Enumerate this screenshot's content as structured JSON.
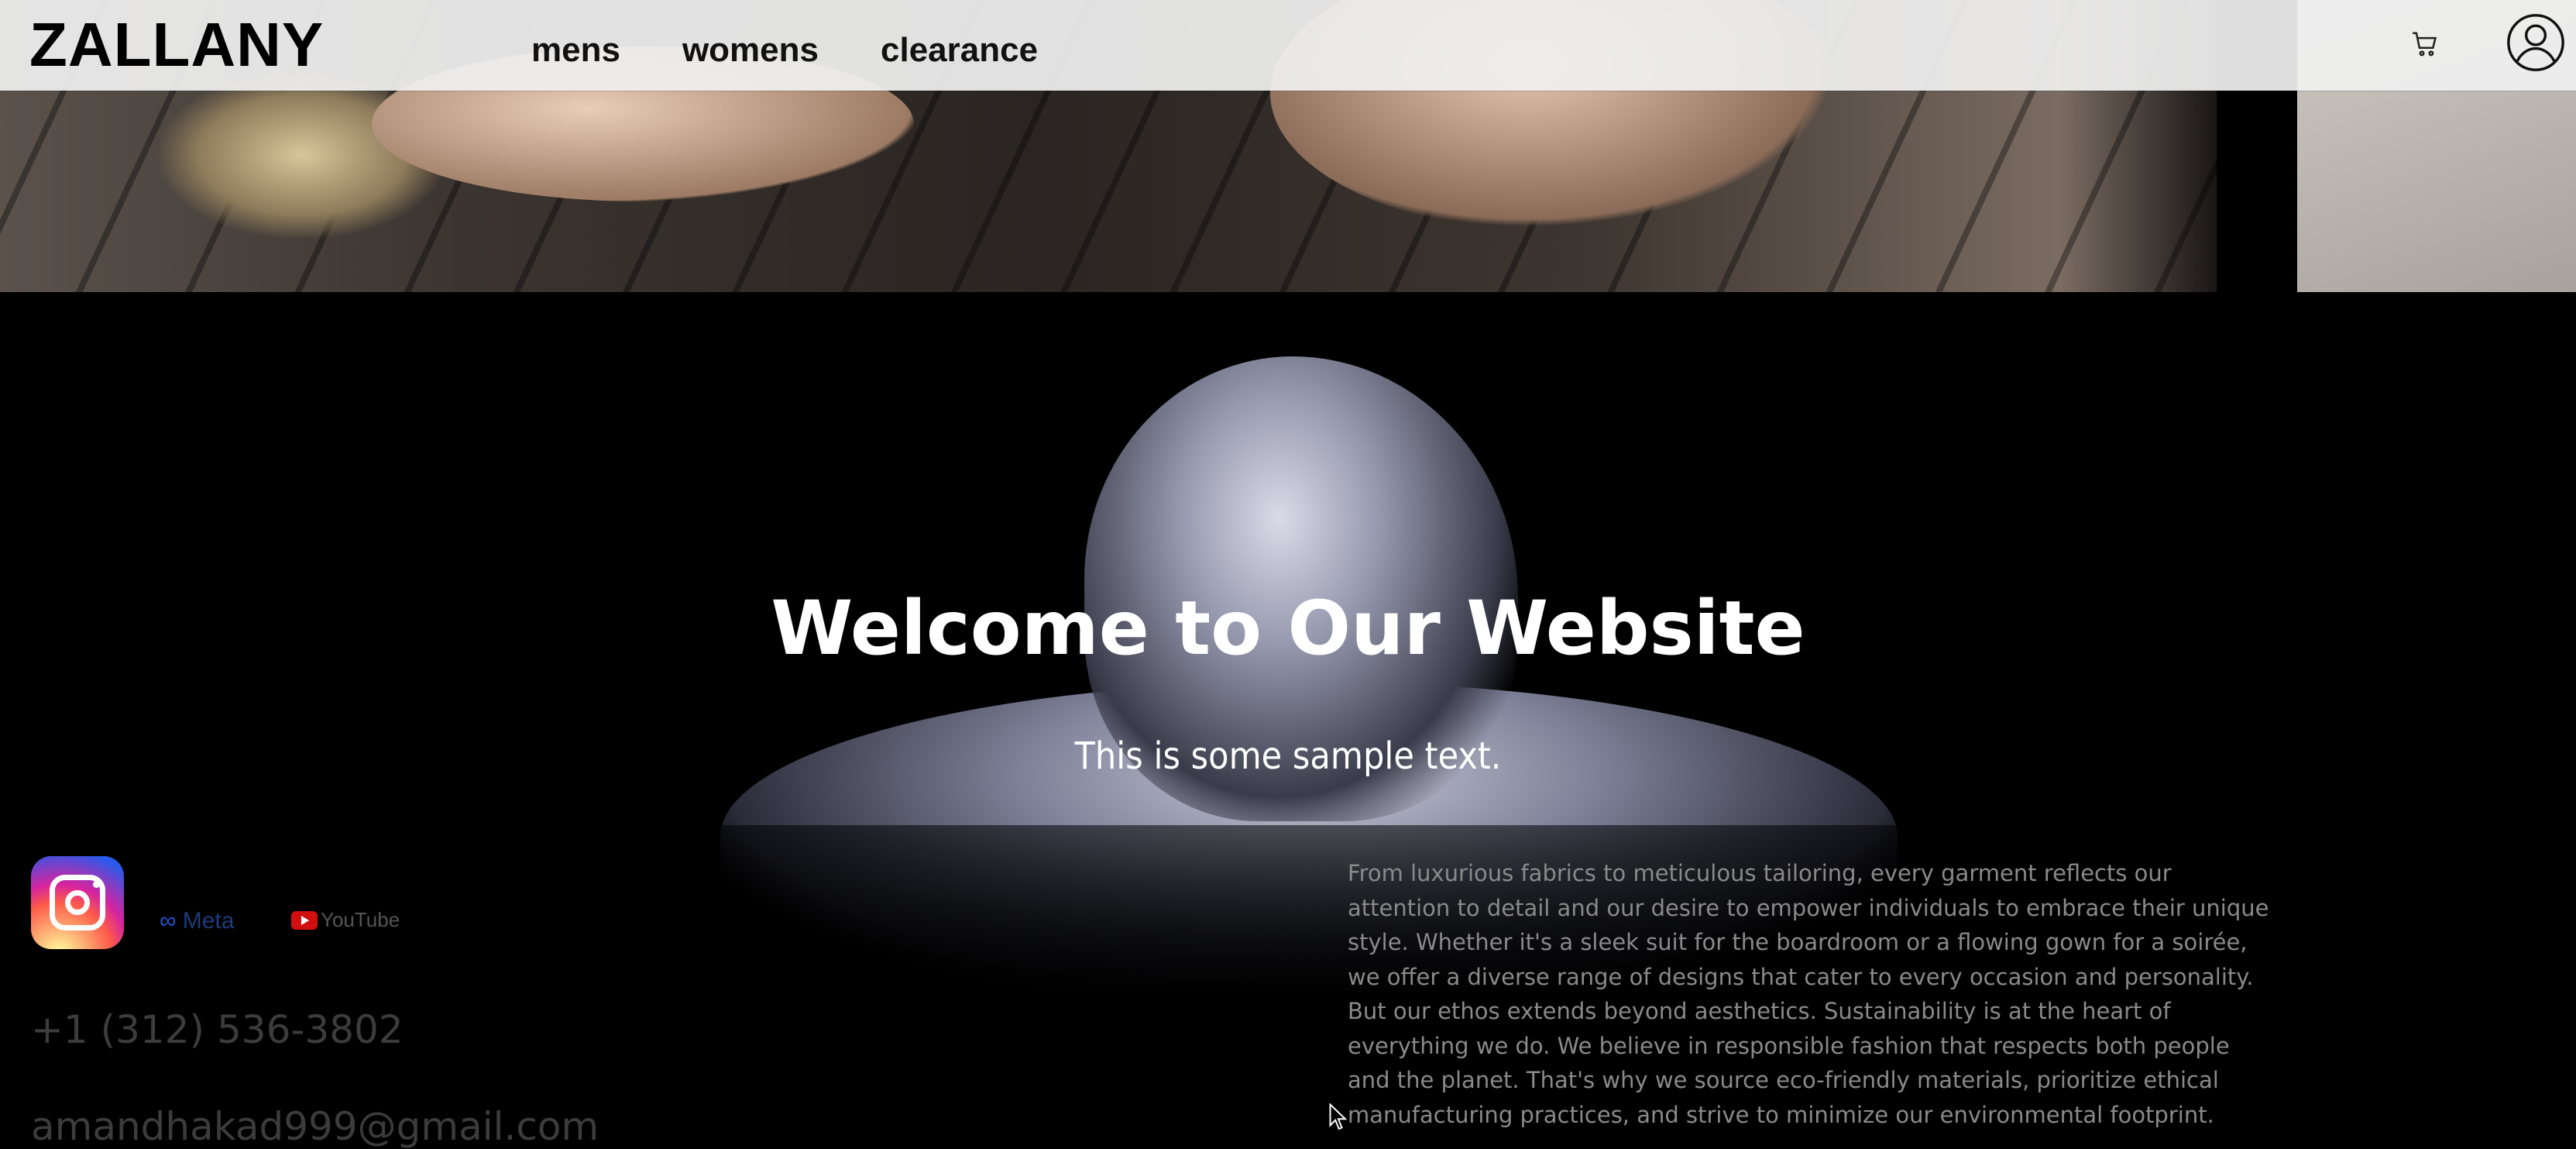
{
  "header": {
    "logo": "ZALLANY",
    "nav": [
      "mens",
      "womens",
      "clearance"
    ],
    "cart_icon": "cart-icon",
    "account_icon": "user-circle-icon"
  },
  "hero": {
    "title": "Welcome to Our Website",
    "subtitle": "This is some sample text."
  },
  "social": {
    "instagram_icon": "instagram-icon",
    "meta_label": "Meta",
    "youtube_label": "YouTube"
  },
  "contact": {
    "phone": "+1 (312) 536-3802",
    "email": "amandhakad999@gmail.com"
  },
  "about": {
    "text": "From luxurious fabrics to meticulous tailoring, every garment reflects our attention to detail and our desire to empower individuals to embrace their unique style. Whether it's a sleek suit for the boardroom or a flowing gown for a soirée, we offer a diverse range of designs that cater to every occasion and personality. But our ethos extends beyond aesthetics. Sustainability is at the heart of everything we do. We believe in responsible fashion that respects both people and the planet. That's why we source eco-friendly materials, prioritize ethical manufacturing practices, and strive to minimize our environmental footprint."
  },
  "colors": {
    "background": "#000000",
    "header_bg": "#f0f0f0",
    "text_muted": "#8a8a8a"
  }
}
